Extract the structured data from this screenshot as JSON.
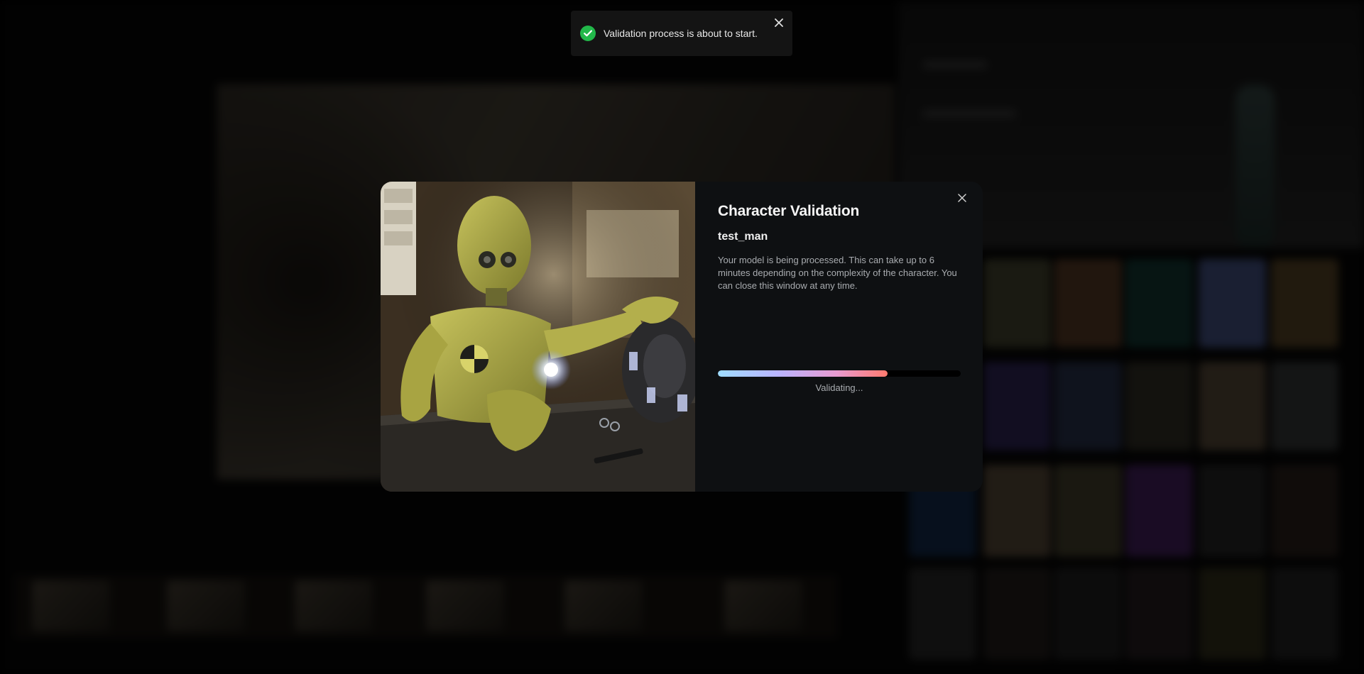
{
  "toast": {
    "message": "Validation process is about to start.",
    "icon": "check-circle-icon",
    "close_icon": "close-icon",
    "accent": "#22b84a"
  },
  "modal": {
    "title": "Character Validation",
    "subtitle": "test_man",
    "description": "Your model is being processed. This can take up to 6 minutes depending on the complexity of the character. You can close this window at any time.",
    "progress_fraction": 0.7,
    "status": "Validating...",
    "close_icon": "close-icon",
    "image": "crash-test-dummy-illustration"
  }
}
